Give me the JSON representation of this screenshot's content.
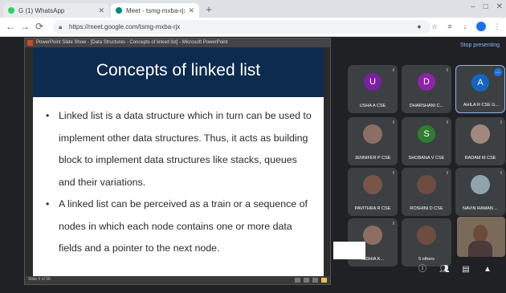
{
  "browser": {
    "tabs": [
      {
        "label": "G (1) WhatsApp",
        "favicon_color": "#25d366"
      },
      {
        "label": "Meet - tsmg-mxba-rjx",
        "favicon_color": "#00897b"
      }
    ],
    "new_tab": "+",
    "address": "https://meet.google.com/tsmg-mxba-rjx",
    "window_controls": [
      "–",
      "□",
      "✕"
    ]
  },
  "meet": {
    "stop_presenting": "Stop presenting",
    "participants": [
      {
        "name": "USHA A CSE",
        "initial": "U",
        "avatar_color": "#7b1fa2"
      },
      {
        "name": "DHARSHANI C...",
        "initial": "D",
        "avatar_color": "#8e24aa"
      },
      {
        "name": "AHILA R CSE G...",
        "initial": "A",
        "avatar_color": "#1565c0",
        "active": true,
        "more": "…"
      },
      {
        "name": "JENNIFER P CSE",
        "initial": "",
        "avatar_color": "#8d6e63"
      },
      {
        "name": "SHOBANA V CSE",
        "initial": "S",
        "avatar_color": "#2e7d32"
      },
      {
        "name": "RADAM M CSE",
        "initial": "",
        "avatar_color": "#a1887f"
      },
      {
        "name": "PAVITHRA R CSE",
        "initial": "",
        "avatar_color": "#795548"
      },
      {
        "name": "ROSHINI D CSE",
        "initial": "",
        "avatar_color": "#6d4c41"
      },
      {
        "name": "NAVIN RAMAN ...",
        "initial": "",
        "avatar_color": "#90a4ae"
      },
      {
        "name": "INDHIA K...",
        "initial": "",
        "avatar_color": "#8d6e63"
      },
      {
        "name": "5 others",
        "initial": "",
        "avatar_color": "#6d4c41"
      }
    ],
    "controls": [
      "captions-icon",
      "people-icon",
      "chat-icon",
      "activities-icon",
      "shield-icon"
    ]
  },
  "presentation": {
    "window_title": "PowerPoint Slide Show - [Data Structures - Concepts of linked list] - Microsoft PowerPoint",
    "slide": {
      "title": "Concepts of linked list",
      "bullets": [
        "Linked list is a data structure which in turn can be used to implement other data structures. Thus, it acts as building block to implement data structures like stacks, queues and their variations.",
        "A linked list can be perceived as a train or a sequence of nodes in which each node contains one or more data fields and a pointer to the next node."
      ]
    },
    "status": "Slide 5 of 36"
  },
  "colors": {
    "slide_header": "#0d2a4f",
    "meet_background": "#202124",
    "tile_background": "#3c4043"
  }
}
